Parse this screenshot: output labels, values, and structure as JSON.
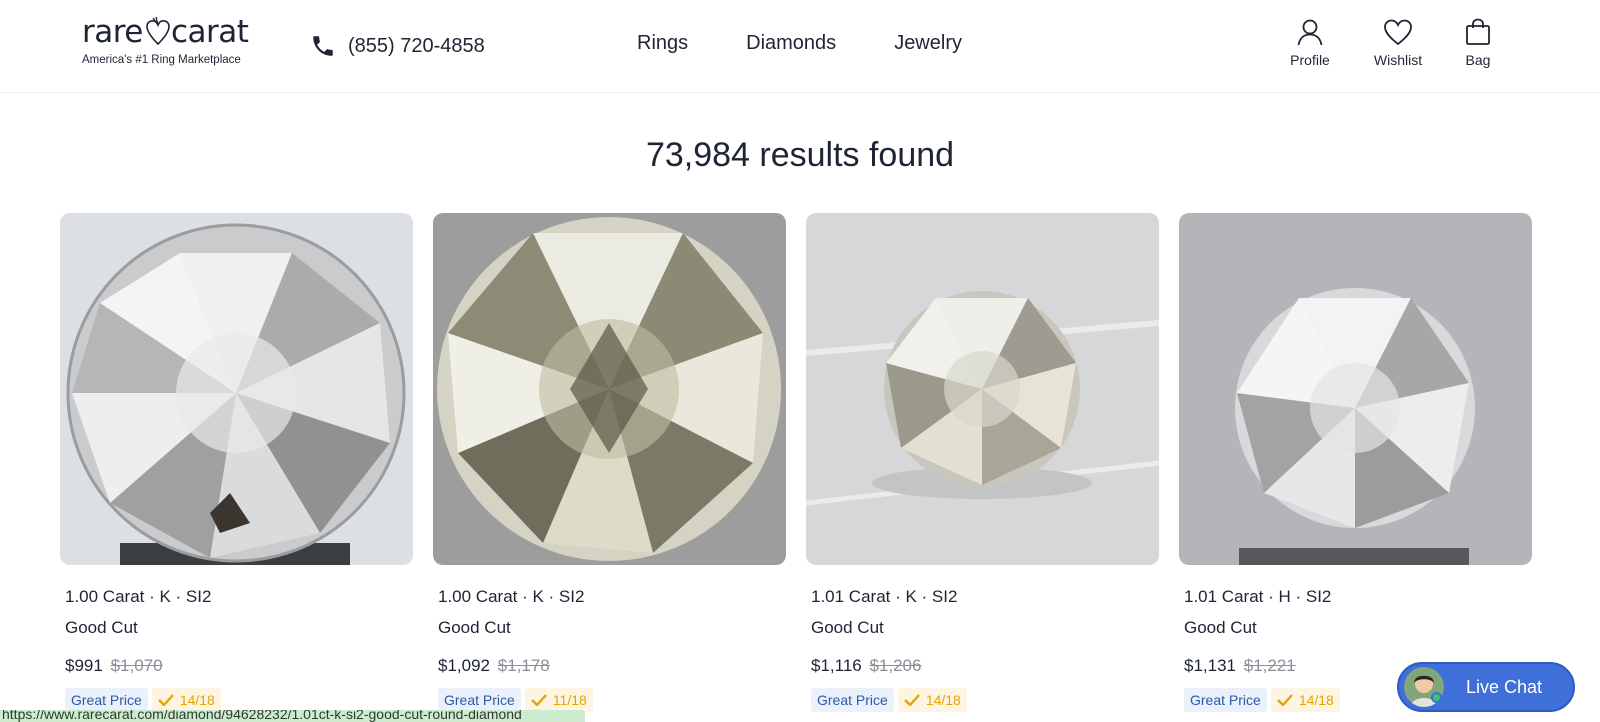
{
  "header": {
    "logo_left": "rare",
    "logo_right": "carat",
    "logo_tagline": "America's #1 Ring Marketplace",
    "phone": "(855) 720-4858",
    "nav": [
      "Rings",
      "Diamonds",
      "Jewelry"
    ],
    "utilities": [
      {
        "label": "Profile",
        "icon": "person-icon"
      },
      {
        "label": "Wishlist",
        "icon": "heart-icon"
      },
      {
        "label": "Bag",
        "icon": "shopping-bag-icon"
      }
    ]
  },
  "results": {
    "title": "73,984 results found"
  },
  "products": [
    {
      "title": "1.00 Carat · K · SI2",
      "cut": "Good Cut",
      "price": "$991",
      "old_price": "$1,070",
      "badge": "Great Price",
      "score": "14/18"
    },
    {
      "title": "1.00 Carat · K · SI2",
      "cut": "Good Cut",
      "price": "$1,092",
      "old_price": "$1,178",
      "badge": "Great Price",
      "score": "11/18"
    },
    {
      "title": "1.01 Carat · K · SI2",
      "cut": "Good Cut",
      "price": "$1,116",
      "old_price": "$1,206",
      "badge": "Great Price",
      "score": "14/18"
    },
    {
      "title": "1.01 Carat · H · SI2",
      "cut": "Good Cut",
      "price": "$1,131",
      "old_price": "$1,221",
      "badge": "Great Price",
      "score": "14/18"
    }
  ],
  "chat": {
    "label": "Live Chat"
  },
  "status_url": "https://www.rarecarat.com/diamond/94628232/1.01ct-k-si2-good-cut-round-diamond",
  "colors": {
    "text": "#1e2433",
    "accent_blue": "#3f6fd8",
    "badge_blue_text": "#2b5aa8",
    "score_gold": "#e7a400",
    "status_green": "#cdeccf"
  }
}
